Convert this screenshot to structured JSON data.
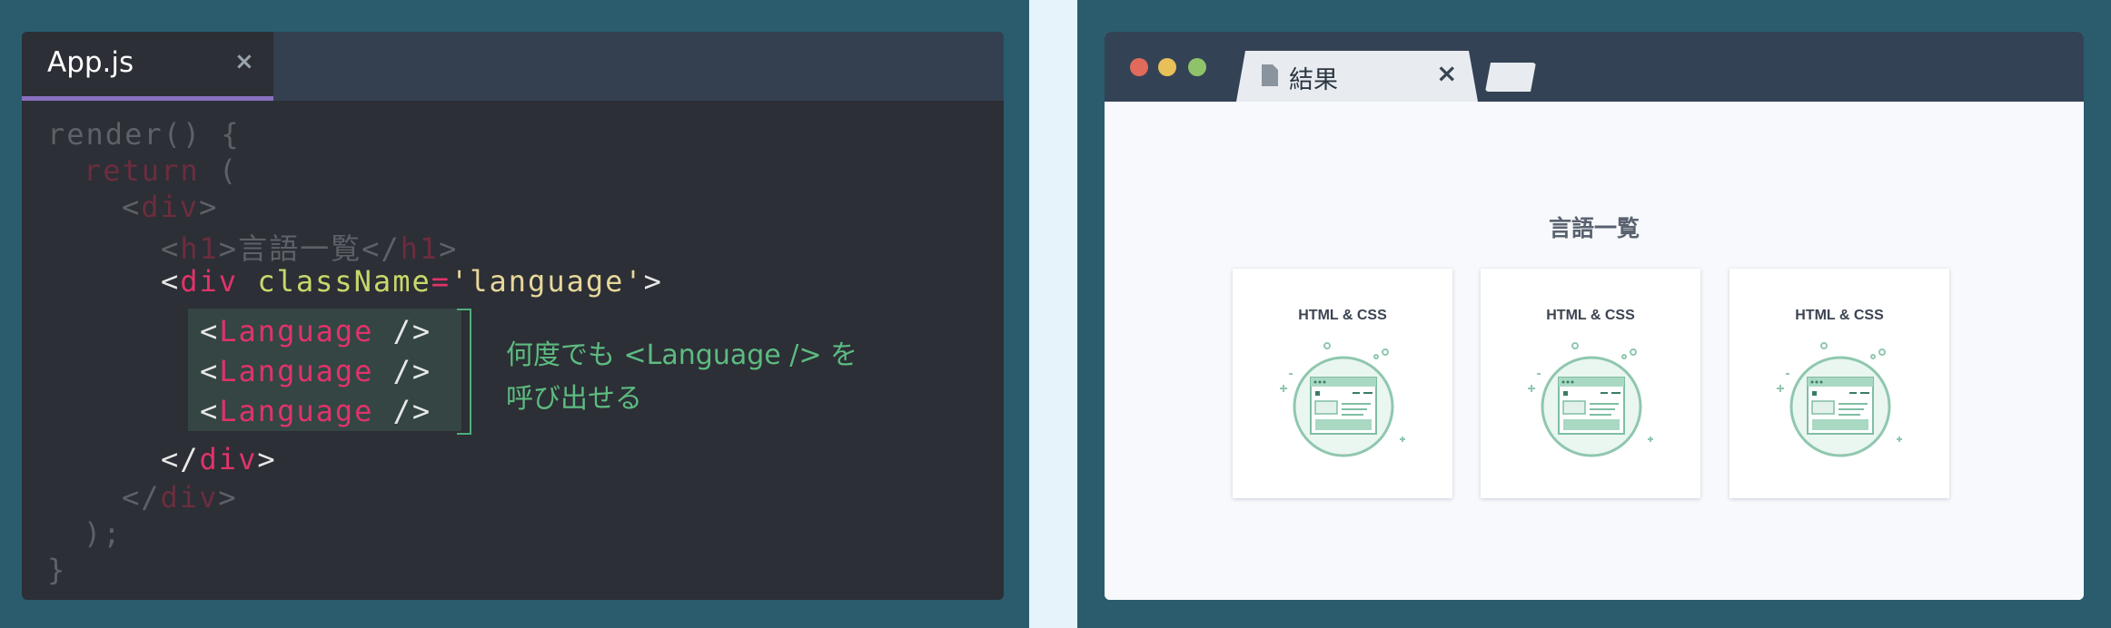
{
  "editor": {
    "tab_title": "App.js",
    "tab_close": "×",
    "code": {
      "l1": "render() {",
      "l2_kw": "return",
      "l2_paren": " (",
      "l3_open": "<",
      "l3_tag": "div",
      "l3_close": ">",
      "l4_open": "<",
      "l4_tag": "h1",
      "l4_mid": ">言語一覧</",
      "l4_tag2": "h1",
      "l4_close": ">",
      "l5_open": "<",
      "l5_tag": "div",
      "l5_attr": " className",
      "l5_eq": "=",
      "l5_val": "'language'",
      "l5_close": ">",
      "lang_open": "<",
      "lang_tag": "Language",
      "lang_close": " />",
      "l9_open": "</",
      "l9_tag": "div",
      "l9_close": ">",
      "l10_open": "</",
      "l10_tag": "div",
      "l10_close": ">",
      "l11": ");",
      "l12": "}"
    },
    "annotation_line1": "何度でも <Language /> を",
    "annotation_line2": "呼び出せる"
  },
  "browser": {
    "tab_title": "結果",
    "tab_close": "×",
    "page_title": "言語一覧",
    "cards": [
      {
        "title": "HTML & CSS"
      },
      {
        "title": "HTML & CSS"
      },
      {
        "title": "HTML & CSS"
      }
    ]
  },
  "colors": {
    "background": "#2a5c6e",
    "editor_bg": "#2c2f35",
    "tag_red": "#e0336a",
    "attr_lime": "#c8d86a",
    "annotation_green": "#5dbb81",
    "tab_underline": "#8a70c0"
  }
}
